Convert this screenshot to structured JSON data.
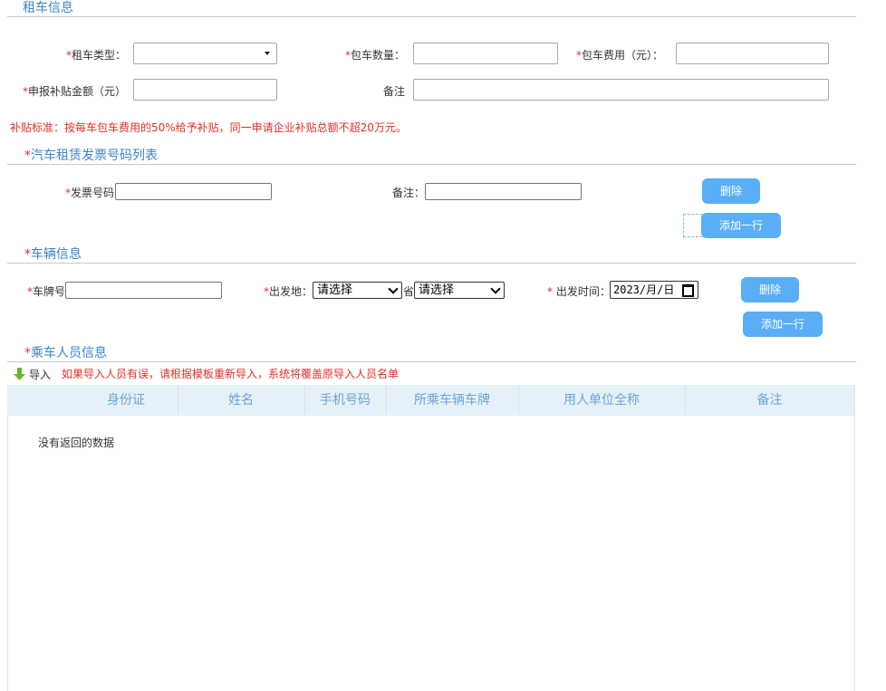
{
  "rental": {
    "title": "租车信息",
    "rental_type_label": "租车类型：",
    "rental_type_value": "",
    "charter_count_label": "包车数量：",
    "charter_count_value": "",
    "charter_fee_label": "包车费用（元）：",
    "charter_fee_value": "",
    "subsidy_amount_label": "申报补贴金额（元）",
    "subsidy_amount_value": "",
    "remark_label": "备注",
    "remark_value": "",
    "subsidy_note": "补贴标准：按每车包车费用的50%给予补贴，同一申请企业补贴总额不超20万元。"
  },
  "invoice": {
    "title": "汽车租赁发票号码列表",
    "number_label": "发票号码",
    "number_value": "",
    "remark_label": "备注：",
    "remark_value": "",
    "delete_label": "删除",
    "add_row_label": "添加一行"
  },
  "vehicle": {
    "title": "车辆信息",
    "plate_label": "车牌号",
    "plate_value": "",
    "departure_label": "出发地：",
    "province_value": "请选择",
    "province_suffix": "省",
    "city_value": "请选择",
    "time_label": "出发时间：",
    "date_value": "2023/月/日",
    "delete_label": "删除",
    "add_row_label": "添加一行"
  },
  "passengers": {
    "title": "乘车人员信息",
    "import_label": "导入",
    "import_warning": "如果导入人员有误，请根据模板重新导入，系统将覆盖原导入人员名单",
    "columns": [
      "身份证",
      "姓名",
      "手机号码",
      "所乘车辆车牌",
      "用人单位全称",
      "备注"
    ],
    "empty_text": "没有返回的数据"
  },
  "required_mark": "*",
  "colors": {
    "accent": "#5aaef5",
    "title": "#3a86c8",
    "required": "#e0302a",
    "header_bg": "#e6f0f8"
  }
}
